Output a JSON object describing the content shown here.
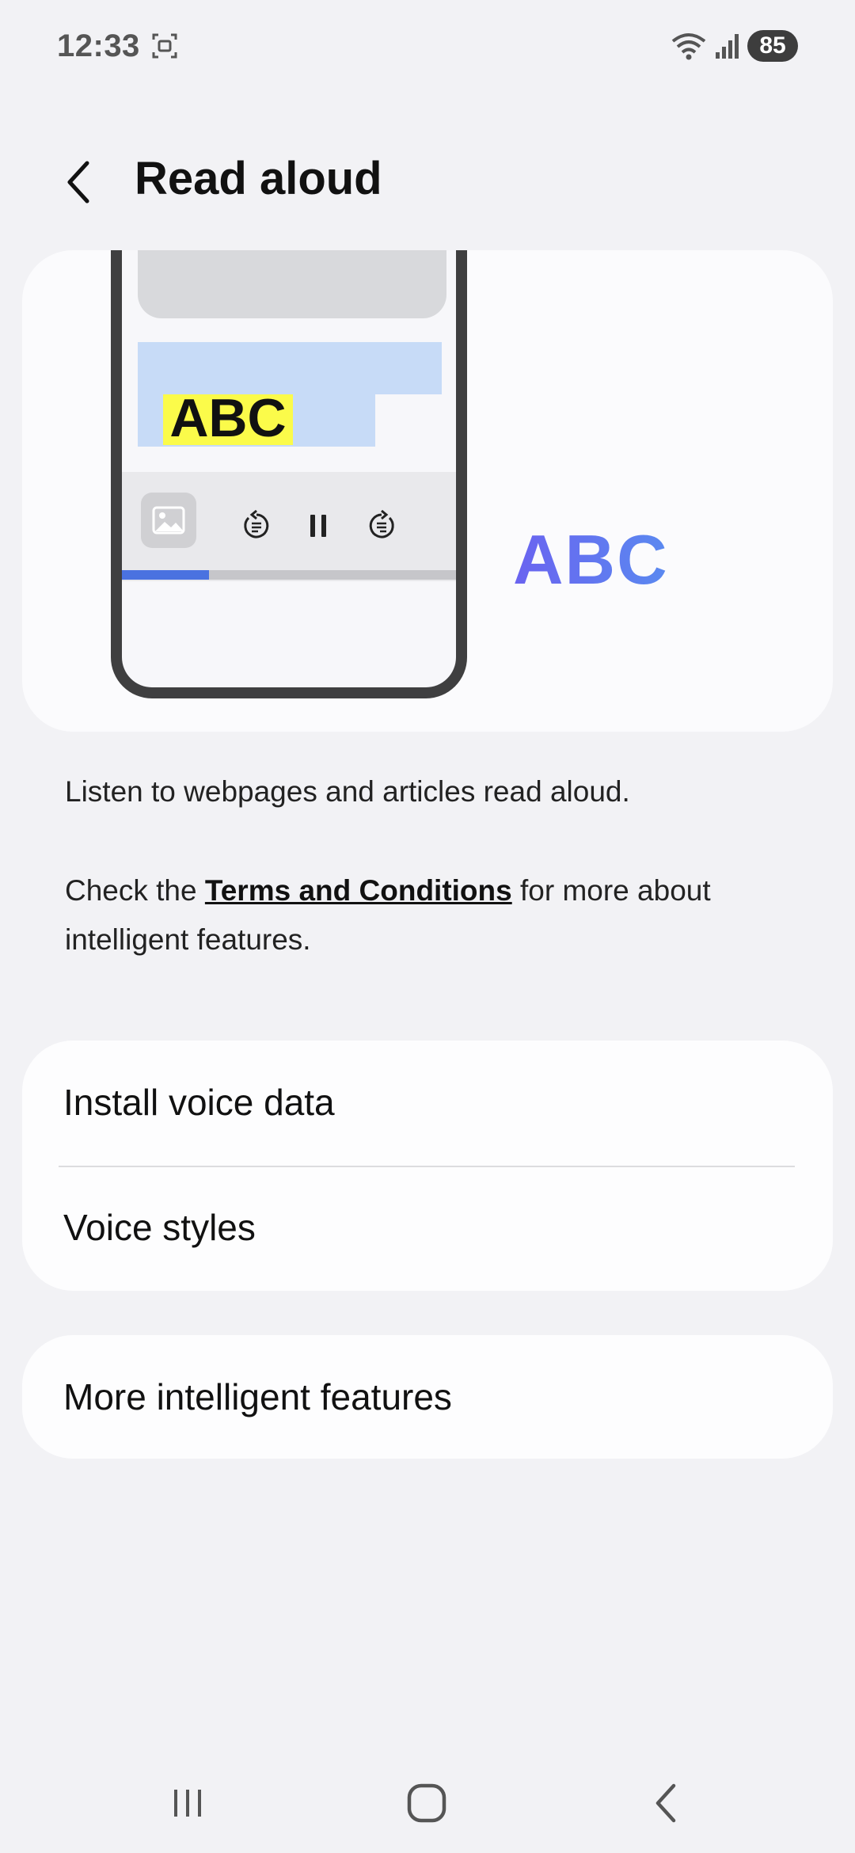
{
  "status_bar": {
    "time": "12:33",
    "battery": "85"
  },
  "header": {
    "title": "Read aloud"
  },
  "hero": {
    "sample_text": "ABC",
    "big_text": "ABC",
    "progress_fraction": 0.26
  },
  "description": "Listen to webpages and articles read aloud.",
  "terms": {
    "prefix": "Check the ",
    "link": "Terms and Conditions",
    "suffix": " for more about intelligent features."
  },
  "settings": {
    "items": [
      {
        "label": "Install voice data"
      },
      {
        "label": "Voice styles"
      }
    ]
  },
  "more": {
    "label": "More intelligent features"
  },
  "icons": {
    "back": "chevron-left-icon",
    "screenshot": "screenshot-icon",
    "wifi": "wifi-icon",
    "signal": "signal-icon",
    "nav_recents": "recents-icon",
    "nav_home": "home-icon",
    "nav_back": "back-icon"
  },
  "colors": {
    "accent_blue": "#4a72e0",
    "highlight_yellow": "#fbfb4a",
    "highlight_blue": "#c7dbf7"
  }
}
